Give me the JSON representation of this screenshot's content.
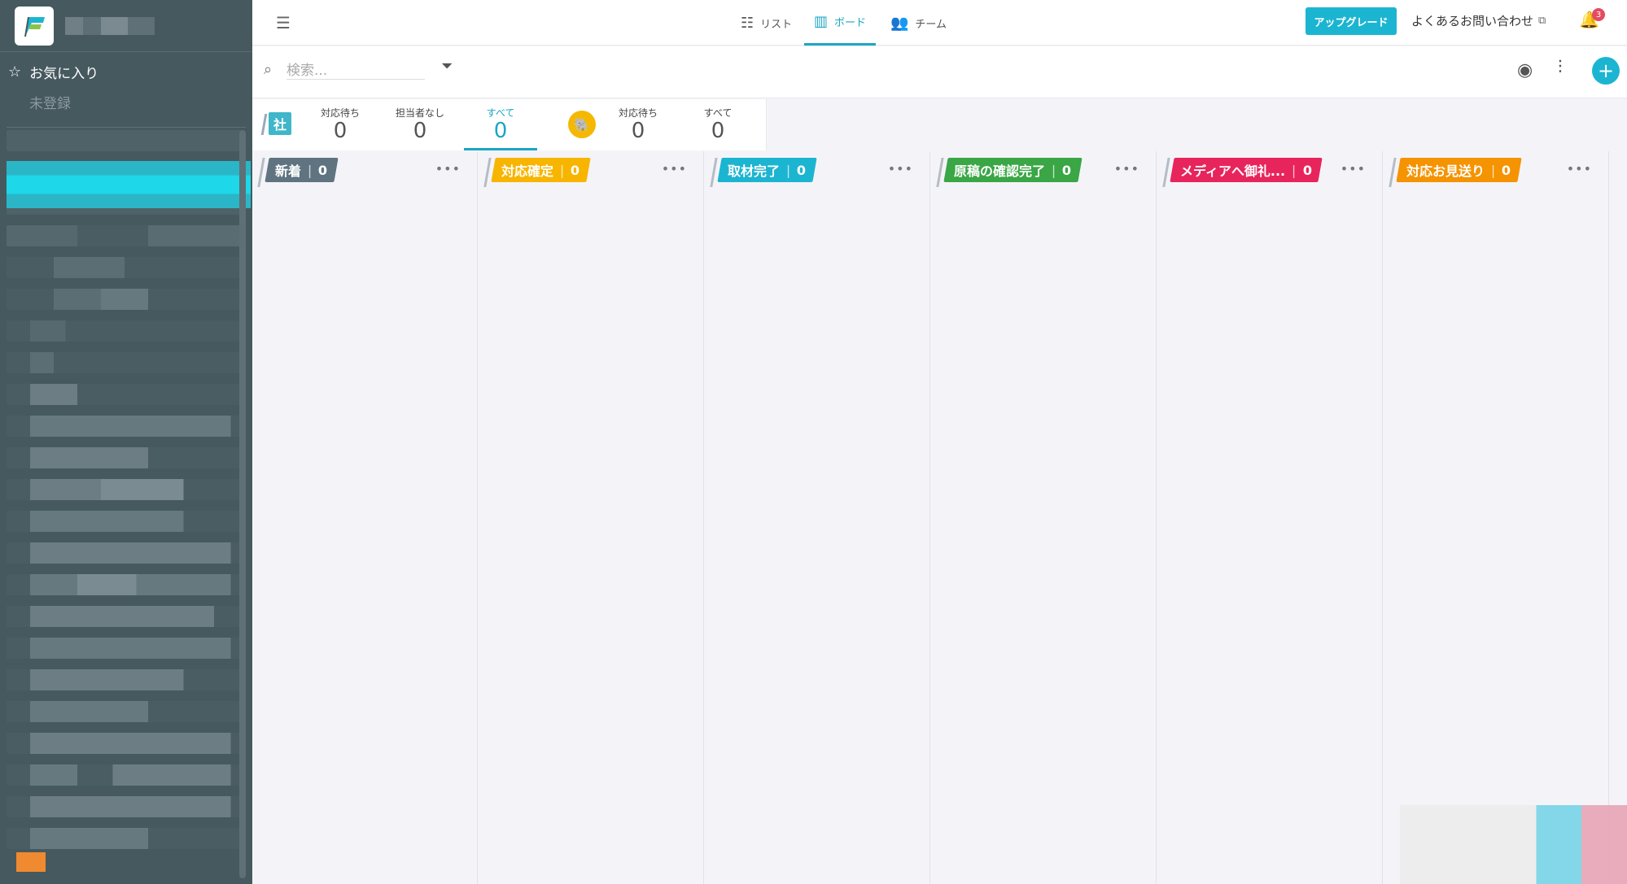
{
  "sidebar": {
    "favorites_label": "お気に入り",
    "unregistered_label": "未登録"
  },
  "topbar": {
    "tabs": [
      {
        "label": "リスト",
        "icon": "list-icon"
      },
      {
        "label": "ボード",
        "icon": "board-icon"
      },
      {
        "label": "チーム",
        "icon": "team-icon"
      }
    ],
    "active_tab": "ボード",
    "upgrade_label": "アップグレード",
    "faq_label": "よくあるお問い合わせ",
    "notification_count": "3"
  },
  "search": {
    "placeholder": "検索..."
  },
  "stats": {
    "team_badge": "社",
    "team": [
      {
        "label": "対応待ち",
        "value": "0"
      },
      {
        "label": "担当者なし",
        "value": "0"
      },
      {
        "label": "すべて",
        "value": "0"
      }
    ],
    "mine": [
      {
        "label": "対応待ち",
        "value": "0"
      },
      {
        "label": "すべて",
        "value": "0"
      }
    ]
  },
  "columns": [
    {
      "name": "新着",
      "count": "0",
      "color": "#5f7480"
    },
    {
      "name": "対応確定",
      "count": "0",
      "color": "#f7b500"
    },
    {
      "name": "取材完了",
      "count": "0",
      "color": "#1cb5d1"
    },
    {
      "name": "原稿の確認完了",
      "count": "0",
      "color": "#3aa645"
    },
    {
      "name": "メディアへ御礼...",
      "count": "0",
      "color": "#e8245c"
    },
    {
      "name": "対応お見送り",
      "count": "0",
      "color": "#f59300"
    }
  ],
  "colors": {
    "accent": "#1cb5d1",
    "sidebar_bg": "#46595f"
  }
}
